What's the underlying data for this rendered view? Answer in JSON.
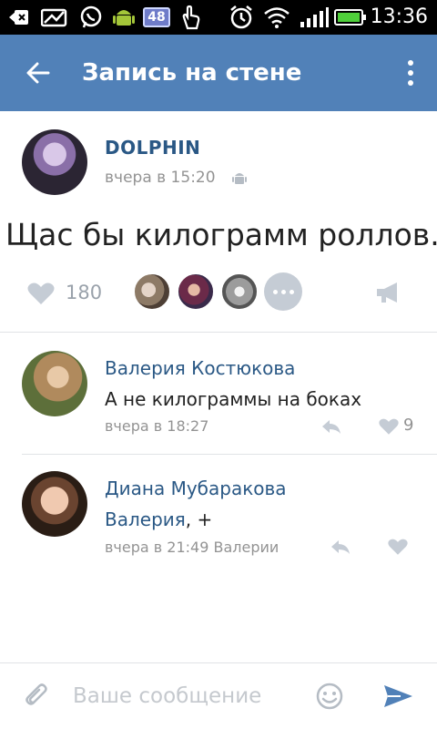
{
  "status_bar": {
    "time": "13:36",
    "notification_count": "48",
    "icons": [
      "back-arrow-icon",
      "photo-icon",
      "whatsapp-icon",
      "android-icon",
      "tap-icon",
      "alarm-icon",
      "wifi-icon",
      "signal-icon",
      "battery-icon"
    ]
  },
  "toolbar": {
    "title": "Запись на стене",
    "back_icon": "arrow-left-icon",
    "more_icon": "more-vertical-icon"
  },
  "post": {
    "author": "DOLPHIN",
    "time": "вчера в 15:20",
    "platform_icon": "android-icon",
    "text": "Щас бы килограмм роллов.",
    "likes": "180",
    "likers_count_shown": 3
  },
  "comments": [
    {
      "author": "Валерия Костюкова",
      "text": "А не килограммы на боках",
      "time": "вчера в 18:27",
      "likes": "9"
    },
    {
      "author": "Диана Мубаракова",
      "mention": "Валерия",
      "text": ", +",
      "time": "вчера в 21:49 Валерии",
      "likes": ""
    }
  ],
  "composer": {
    "placeholder": "Ваше сообщение"
  },
  "colors": {
    "toolbar": "#5181b8",
    "link": "#2a5885",
    "secondary_text": "#939393"
  }
}
